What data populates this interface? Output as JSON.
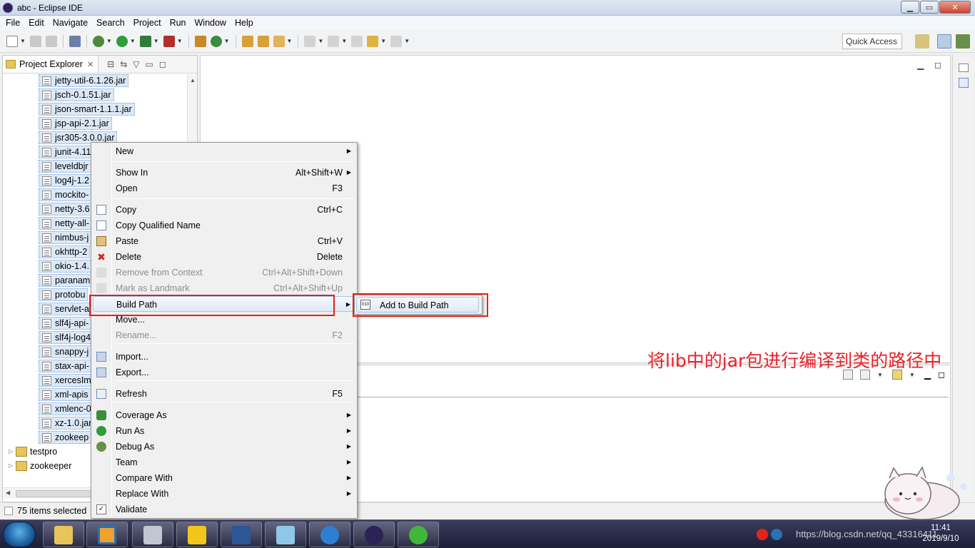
{
  "window": {
    "title": "abc - Eclipse IDE",
    "minimize": "▁",
    "maximize": "▭",
    "close": "✕"
  },
  "menubar": [
    "File",
    "Edit",
    "Navigate",
    "Search",
    "Project",
    "Run",
    "Window",
    "Help"
  ],
  "toolbar": {
    "quick_access": "Quick Access"
  },
  "project_explorer": {
    "tab_label": "Project Explorer",
    "jars": [
      "jetty-util-6.1.26.jar",
      "jsch-0.1.51.jar",
      "json-smart-1.1.1.jar",
      "jsp-api-2.1.jar",
      "jsr305-3.0.0.jar",
      "junit-4.11",
      "leveldbjr",
      "log4j-1.2",
      "mockito-",
      "netty-3.6",
      "netty-all-",
      "nimbus-j",
      "okhttp-2",
      "okio-1.4.",
      "paranam",
      "protobu",
      "servlet-a",
      "slf4j-api-",
      "slf4j-log4",
      "snappy-j",
      "stax-api-",
      "xercesIm",
      "xml-apis",
      "xmlenc-0",
      "xz-1.0.jar",
      "zookeep"
    ],
    "projects": [
      "testpro",
      "zookeeper"
    ]
  },
  "status": {
    "selection": "75 items selected"
  },
  "context_menu": {
    "items": [
      {
        "label": "New",
        "shortcut": "",
        "submenu": true,
        "disabled": false,
        "icon": ""
      },
      {
        "label": "Show In",
        "shortcut": "Alt+Shift+W",
        "submenu": true,
        "disabled": false,
        "icon": ""
      },
      {
        "label": "Open",
        "shortcut": "F3",
        "submenu": false,
        "disabled": false,
        "icon": ""
      },
      {
        "label": "Copy",
        "shortcut": "Ctrl+C",
        "submenu": false,
        "disabled": false,
        "icon": "copy-icon"
      },
      {
        "label": "Copy Qualified Name",
        "shortcut": "",
        "submenu": false,
        "disabled": false,
        "icon": "copy-qualified-icon"
      },
      {
        "label": "Paste",
        "shortcut": "Ctrl+V",
        "submenu": false,
        "disabled": false,
        "icon": "paste-icon"
      },
      {
        "label": "Delete",
        "shortcut": "Delete",
        "submenu": false,
        "disabled": false,
        "icon": "delete-icon"
      },
      {
        "label": "Remove from Context",
        "shortcut": "Ctrl+Alt+Shift+Down",
        "submenu": false,
        "disabled": true,
        "icon": "remove-context-icon"
      },
      {
        "label": "Mark as Landmark",
        "shortcut": "Ctrl+Alt+Shift+Up",
        "submenu": false,
        "disabled": true,
        "icon": "landmark-icon"
      },
      {
        "label": "Build Path",
        "shortcut": "",
        "submenu": true,
        "disabled": false,
        "icon": ""
      },
      {
        "label": "Move...",
        "shortcut": "",
        "submenu": false,
        "disabled": false,
        "icon": ""
      },
      {
        "label": "Rename...",
        "shortcut": "F2",
        "submenu": false,
        "disabled": true,
        "icon": ""
      },
      {
        "label": "Import...",
        "shortcut": "",
        "submenu": false,
        "disabled": false,
        "icon": "import-icon"
      },
      {
        "label": "Export...",
        "shortcut": "",
        "submenu": false,
        "disabled": false,
        "icon": "export-icon"
      },
      {
        "label": "Refresh",
        "shortcut": "F5",
        "submenu": false,
        "disabled": false,
        "icon": "refresh-icon"
      },
      {
        "label": "Coverage As",
        "shortcut": "",
        "submenu": true,
        "disabled": false,
        "icon": "coverage-icon"
      },
      {
        "label": "Run As",
        "shortcut": "",
        "submenu": true,
        "disabled": false,
        "icon": "run-icon"
      },
      {
        "label": "Debug As",
        "shortcut": "",
        "submenu": true,
        "disabled": false,
        "icon": "debug-icon"
      },
      {
        "label": "Team",
        "shortcut": "",
        "submenu": true,
        "disabled": false,
        "icon": ""
      },
      {
        "label": "Compare With",
        "shortcut": "",
        "submenu": true,
        "disabled": false,
        "icon": ""
      },
      {
        "label": "Replace With",
        "shortcut": "",
        "submenu": true,
        "disabled": false,
        "icon": ""
      },
      {
        "label": "Validate",
        "shortcut": "",
        "submenu": false,
        "disabled": false,
        "icon": "validate-icon"
      }
    ],
    "submenu_item": "Add to Build Path",
    "submenu_icon_text": "010"
  },
  "annotation": "将lib中的jar包进行编译到类的路径中",
  "taskbar": {
    "tray_text": "https://blog.csdn.net/qq_43316411",
    "time": "11:41",
    "date": "2019/9/10"
  },
  "colors": {
    "highlight_red": "#e2231a",
    "selection_blue": "#dbe8f7"
  }
}
